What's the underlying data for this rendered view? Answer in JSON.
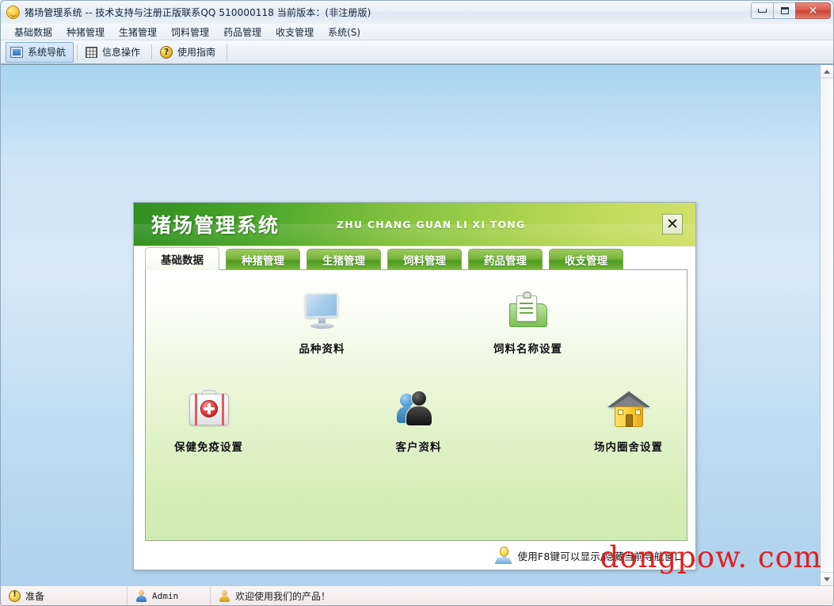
{
  "window": {
    "title": "猪场管理系统 -- 技术支持与注册正版联系QQ 510000118    当前版本：(非注册版)",
    "icon": "pig-face-icon",
    "controls": {
      "minimize": "minimize-button",
      "maximize": "maximize-button",
      "close": "✕"
    }
  },
  "menubar": {
    "items": [
      {
        "label": "基础数据"
      },
      {
        "label": "种猪管理"
      },
      {
        "label": "生猪管理"
      },
      {
        "label": "饲料管理"
      },
      {
        "label": "药品管理"
      },
      {
        "label": "收支管理"
      },
      {
        "label": "系统(S)"
      }
    ]
  },
  "toolbar": {
    "buttons": [
      {
        "label": "系统导航",
        "icon": "navigation-icon",
        "pressed": true
      },
      {
        "label": "信息操作",
        "icon": "grid-icon",
        "pressed": false
      },
      {
        "label": "使用指南",
        "icon": "help-question-icon",
        "pressed": false
      }
    ]
  },
  "nav_dialog": {
    "title": "猪场管理系统",
    "pinyin": "ZHU CHANG GUAN LI XI TONG",
    "close_label": "✕",
    "tabs": [
      {
        "label": "基础数据",
        "active": true
      },
      {
        "label": "种猪管理",
        "active": false
      },
      {
        "label": "生猪管理",
        "active": false
      },
      {
        "label": "饲料管理",
        "active": false
      },
      {
        "label": "药品管理",
        "active": false
      },
      {
        "label": "收支管理",
        "active": false
      }
    ],
    "row1": [
      {
        "label": "品种资料",
        "icon": "monitor-icon"
      },
      {
        "label": "饲料名称设置",
        "icon": "clipboard-folder-icon"
      }
    ],
    "row2": [
      {
        "label": "保健免疫设置",
        "icon": "medical-kit-icon"
      },
      {
        "label": "客户资料",
        "icon": "users-icon"
      },
      {
        "label": "场内圈舍设置",
        "icon": "house-icon"
      }
    ],
    "hint": "使用F8键可以显示/隐藏当前导航窗口",
    "hint_icon": "lightbulb-icon"
  },
  "statusbar": {
    "ready": "准备",
    "user": "Admin",
    "message": "欢迎使用我们的产品！"
  },
  "watermark": "dongpow. com",
  "colors": {
    "header_green_dark": "#2f8f20",
    "header_green_light": "#d2e06a",
    "tab_green": "#7ab63b",
    "panel_green": "#d4edb6",
    "close_red": "#c74233",
    "watermark_red": "#e02020",
    "client_blue": "#cfe4f5"
  }
}
